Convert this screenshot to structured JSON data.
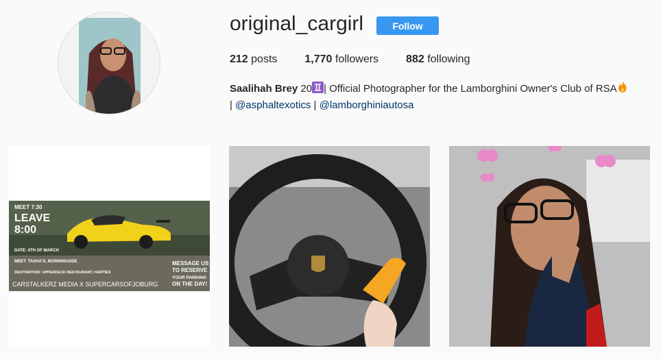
{
  "profile": {
    "username": "original_cargirl",
    "follow_label": "Follow",
    "posts_count": "212",
    "posts_label": "posts",
    "followers_count": "1,770",
    "followers_label": "followers",
    "following_count": "882",
    "following_label": "following",
    "full_name": "Saalihah Brey",
    "bio_age": "20",
    "bio_text": "| Official Photographer for the Lamborghini Owner's Club of RSA",
    "bio_sep1": "|",
    "bio_sep2": "|",
    "link1": "@asphaltexotics",
    "link2": "@lamborghiniautosa"
  },
  "posts": [
    {
      "poster": {
        "meet_time": "MEET 7:30",
        "leave_word": "LEAVE",
        "leave_time": "8:00",
        "date": "DATE: 4TH OF MARCH",
        "meet_place": "MEET: TASHA'S, MORNINGSIDE",
        "destination": "DESTINATION: UPPERDECK RESTAURANT, HARTIES",
        "message_line1": "MESSAGE US",
        "message_line2": "TO RESERVE",
        "message_line3": "YOUR PARKING",
        "message_line4": "ON THE DAY!",
        "footer": "CARSTALKERZ MEDIA X SUPERCARSOFJOBURG"
      }
    },
    {
      "image": "steering-wheel-photo"
    },
    {
      "image": "selfie-photo"
    }
  ],
  "colors": {
    "accent": "#3897f0",
    "link": "#003569"
  }
}
